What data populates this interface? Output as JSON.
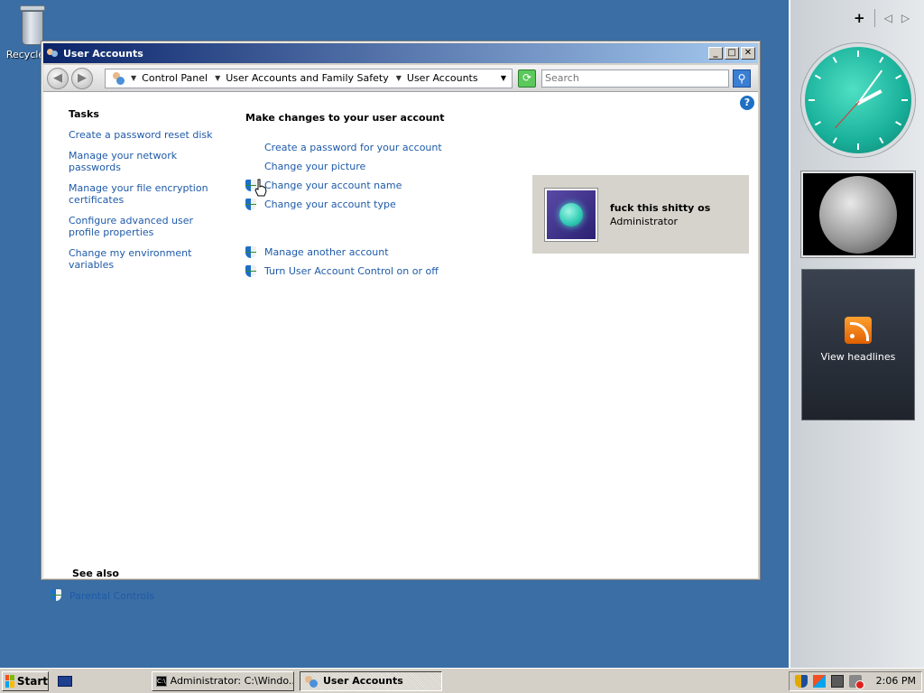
{
  "desktop": {
    "recycle_label": "Recycle"
  },
  "window": {
    "title": "User Accounts",
    "controls": {
      "minimize": "_",
      "maximize": "□",
      "close": "✕"
    }
  },
  "address": {
    "crumbs": [
      "Control Panel",
      "User Accounts and Family Safety",
      "User Accounts"
    ],
    "search_placeholder": "Search"
  },
  "tasks": {
    "heading": "Tasks",
    "links": [
      "Create a password reset disk",
      "Manage your network passwords",
      "Manage your file encryption certificates",
      "Configure advanced user profile properties",
      "Change my environment variables"
    ]
  },
  "main": {
    "heading": "Make changes to your user account",
    "actions": [
      "Create a password for your account",
      "Change your picture",
      "Change your account name",
      "Change your account type"
    ],
    "other_actions": [
      "Manage another account",
      "Turn User Account Control on or off"
    ]
  },
  "user": {
    "name": "fuck this shitty os",
    "role": "Administrator"
  },
  "see_also": {
    "heading": "See also",
    "links": [
      "Parental Controls"
    ]
  },
  "sidebar": {
    "feed_label": "View headlines"
  },
  "taskbar": {
    "start_label": "Start",
    "tasks": [
      "Administrator: C:\\Windo...",
      "User Accounts"
    ],
    "clock": "2:06 PM"
  },
  "colors": {
    "desktop": "#3a6ea5",
    "link": "#1e5aa8",
    "titlebar_start": "#0a246a",
    "titlebar_end": "#a6caf0"
  }
}
